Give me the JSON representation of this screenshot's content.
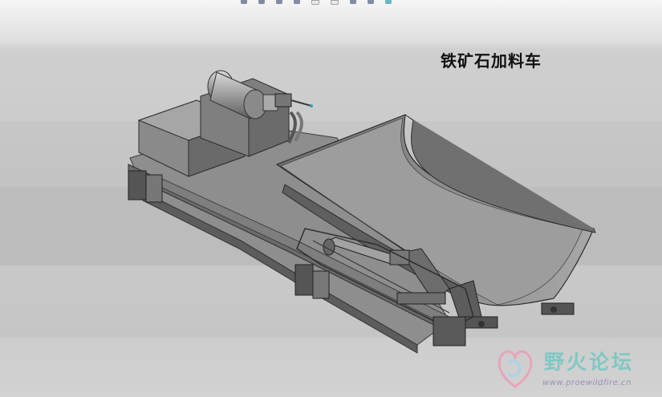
{
  "toolbar": {
    "icons": [
      "zoom-icon",
      "rotate-icon",
      "pan-icon",
      "edit-icon",
      "view-icon",
      "display-icon",
      "save-icon",
      "spin-icon",
      "settings-icon"
    ]
  },
  "title": "铁矿石加料车",
  "watermark": {
    "name": "野火论坛",
    "url": "www.proewildfire.cn"
  },
  "colors": {
    "model_dark": "#5a5a5a",
    "model_mid": "#8a8a8a",
    "model_light": "#b8b8b8",
    "watermark_text": "#7fc8c4",
    "watermark_url": "#9a8fb8"
  }
}
